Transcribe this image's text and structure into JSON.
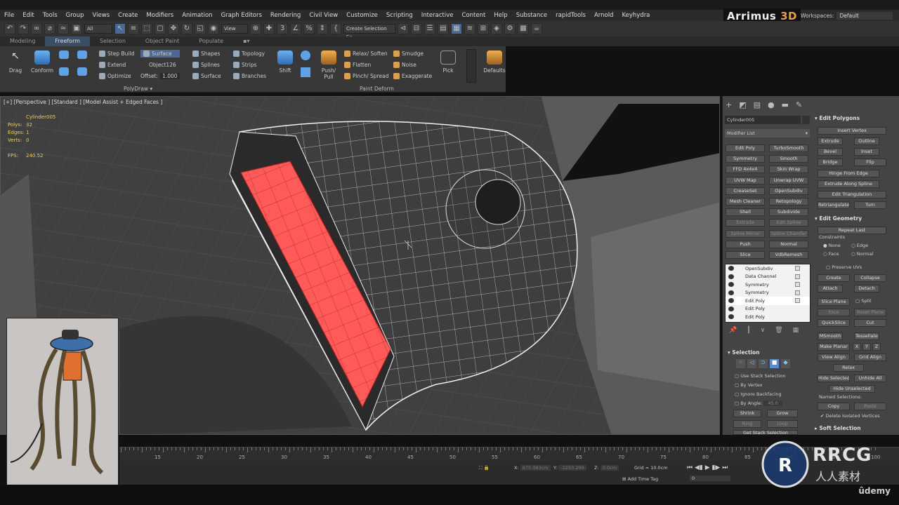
{
  "menu": [
    "File",
    "Edit",
    "Tools",
    "Group",
    "Views",
    "Create",
    "Modifiers",
    "Animation",
    "Graph Editors",
    "Rendering",
    "Civil View",
    "Customize",
    "Scripting",
    "Interactive",
    "Content",
    "Help",
    "Substance",
    "rapidTools",
    "Arnold",
    "Keyhydra"
  ],
  "logo": {
    "main": "Arrimus",
    "accent": "3D"
  },
  "workspaces": {
    "label": "Workspaces:",
    "value": "Default"
  },
  "toolbar": {
    "filter_value": "All",
    "view_value": "View",
    "create_selection_value": "Create Selection Se"
  },
  "ribbon_tabs": [
    {
      "label": "Modeling",
      "active": false
    },
    {
      "label": "Freeform",
      "active": true
    },
    {
      "label": "Selection",
      "active": false
    },
    {
      "label": "Object Paint",
      "active": false
    },
    {
      "label": "Populate",
      "active": false
    }
  ],
  "ribbon": {
    "drag": "Drag",
    "conform": "Conform",
    "step_build": "Step Build",
    "extend": "Extend",
    "optimize": "Optimize",
    "surface_btn": "Surface",
    "object_name": "Object126",
    "offset_label": "Offset:",
    "offset_value": "1.000",
    "shapes": "Shapes",
    "splines": "Splines",
    "surface": "Surface",
    "topology": "Topology",
    "strips": "Strips",
    "branches": "Branches",
    "shift": "Shift",
    "push_pull": "Push/ Pull",
    "relax_soften": "Relax/ Soften",
    "flatten": "Flatten",
    "pinch_spread": "Pinch/ Spread",
    "smudge": "Smudge",
    "noise": "Noise",
    "exaggerate": "Exaggerate",
    "pick": "Pick",
    "defaults": "Defaults",
    "group_polydraw": "PolyDraw",
    "group_paint_deform": "Paint Deform"
  },
  "viewport": {
    "label": "[+] [Perspective ] [Standard ] [Model Assist + Edged Faces ]",
    "object_name": "Cylinder005",
    "stats": [
      {
        "label": "Polys:",
        "value": "32"
      },
      {
        "label": "Edges:",
        "value": "1"
      },
      {
        "label": "Verts:",
        "value": "0"
      }
    ],
    "fps_label": "FPS:",
    "fps_value": "240.52"
  },
  "command_panel": {
    "object_name": "Cylinder005",
    "modifier_list": "Modifier List",
    "modifier_buttons": [
      "Edit Poly",
      "TurboSmooth",
      "Symmetry",
      "Smooth",
      "FFD 4x4x4",
      "Skin Wrap",
      "UVW Map",
      "Unwrap UVW",
      "CreaseSet",
      "OpenSubdiv",
      "Mesh Cleaner",
      "Retopology",
      "Shell",
      "Subdivide",
      "Extrude",
      "Edit Spline",
      "Spline Mirror",
      "Spline Chamfer",
      "Push",
      "Normal",
      "Slice",
      "VdbRemesh"
    ],
    "stack": [
      "OpenSubdiv",
      "Data Channel",
      "Symmetry",
      "Symmetry",
      "Edit Poly",
      "Edit Poly",
      "Edit Poly"
    ],
    "selection": {
      "title": "Selection",
      "use_stack": "Use Stack Selection",
      "by_vertex": "By Vertex",
      "ignore_backfacing": "Ignore Backfacing",
      "by_angle": "By Angle:",
      "by_angle_value": "45.0",
      "shrink": "Shrink",
      "grow": "Grow",
      "ring": "Ring",
      "loop": "Loop",
      "get_stack": "Get Stack Selection"
    },
    "edit_polygons": {
      "title": "Edit Polygons",
      "insert_vertex": "Insert Vertex",
      "extrude": "Extrude",
      "outline": "Outline",
      "bevel": "Bevel",
      "inset": "Inset",
      "bridge": "Bridge",
      "flip": "Flip",
      "hinge": "Hinge From Edge",
      "extrude_spline": "Extrude Along Spline",
      "edit_triangulation": "Edit Triangulation",
      "retriangulate": "Retriangulate",
      "turn": "Turn"
    },
    "edit_geometry": {
      "title": "Edit Geometry",
      "repeat_last": "Repeat Last",
      "constraints": "Constraints",
      "none": "None",
      "edge": "Edge",
      "face": "Face",
      "normal": "Normal",
      "preserve_uvs": "Preserve UVs",
      "create": "Create",
      "collapse": "Collapse",
      "attach": "Attach",
      "detach": "Detach",
      "slice_plane": "Slice Plane",
      "split": "Split",
      "slice": "Slice",
      "reset_plane": "Reset Plane",
      "quickslice": "QuickSlice",
      "cut": "Cut",
      "msmooth": "MSmooth",
      "tessellate": "Tessellate",
      "make_planar": "Make Planar",
      "x": "X",
      "y": "Y",
      "z": "Z",
      "view_align": "View Align",
      "grid_align": "Grid Align",
      "relax": "Relax",
      "hide_selected": "Hide Selected",
      "unhide_all": "Unhide All",
      "hide_unselected": "Hide Unselected",
      "named_selections": "Named Selections:",
      "copy": "Copy",
      "paste": "Paste",
      "delete_isolated": "Delete Isolated Vertices"
    },
    "soft_selection": "Soft Selection"
  },
  "timeline": {
    "ticks": [
      "15",
      "20",
      "25",
      "30",
      "35",
      "40",
      "45",
      "50",
      "55",
      "60",
      "65",
      "70",
      "75",
      "80",
      "85",
      "90",
      "95",
      "100"
    ]
  },
  "status": {
    "x_label": "X:",
    "x_value": "975.083cm",
    "y_label": "Y:",
    "y_value": "-1293.299",
    "z_label": "Z:",
    "z_value": "0.0cm",
    "grid": "Grid = 10.0cm",
    "add_time_tag": "Add Time Tag",
    "frame_value": "0"
  },
  "watermark": {
    "brand": "RRCG",
    "sub": "人人素材",
    "udemy": "ûdemy"
  },
  "colors": {
    "accent": "#4a6a95",
    "selection_red": "#ff5a5a",
    "stats_yellow": "#e8d060"
  }
}
